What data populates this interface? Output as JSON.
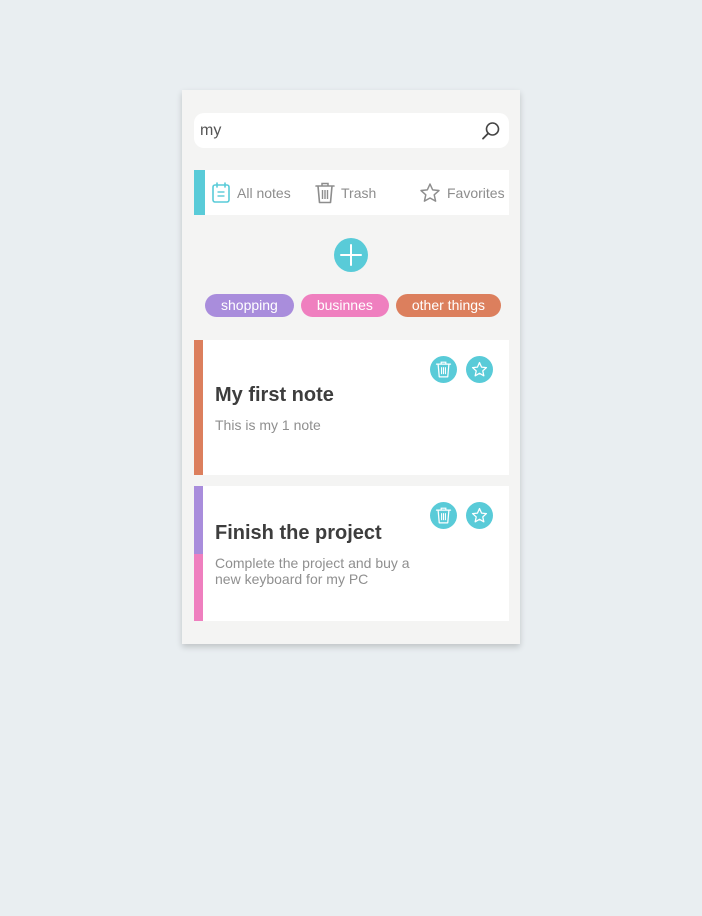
{
  "colors": {
    "accent": "#59cbd8",
    "page_background": "#e9eef1",
    "panel_background": "#f4f4f3",
    "card_background": "#ffffff",
    "tag_shopping": "#a98ddc",
    "tag_business": "#ef7fbf",
    "tag_other": "#dc7f5d"
  },
  "search": {
    "value": "my",
    "placeholder": "",
    "icon": "search-icon"
  },
  "nav": {
    "items": [
      {
        "label": "All notes",
        "icon": "notes-icon",
        "active": true
      },
      {
        "label": "Trash",
        "icon": "trash-icon",
        "active": false
      },
      {
        "label": "Favorites",
        "icon": "star-icon",
        "active": false
      }
    ]
  },
  "add_button": {
    "icon": "plus-icon"
  },
  "tags": [
    {
      "label": "shopping",
      "color": "#a98ddc"
    },
    {
      "label": "businnes",
      "color": "#ef7fbf"
    },
    {
      "label": "other things",
      "color": "#dc7f5d"
    }
  ],
  "notes": [
    {
      "title": "My first note",
      "body": "This is my 1 note",
      "tag_colors": [
        "#dc7f5d"
      ],
      "actions": [
        "trash-icon",
        "star-icon"
      ]
    },
    {
      "title": "Finish the project",
      "body": "Complete the project and buy a new keyboard for my PC",
      "tag_colors": [
        "#a98ddc",
        "#ef7fbf"
      ],
      "actions": [
        "trash-icon",
        "star-icon"
      ]
    }
  ]
}
